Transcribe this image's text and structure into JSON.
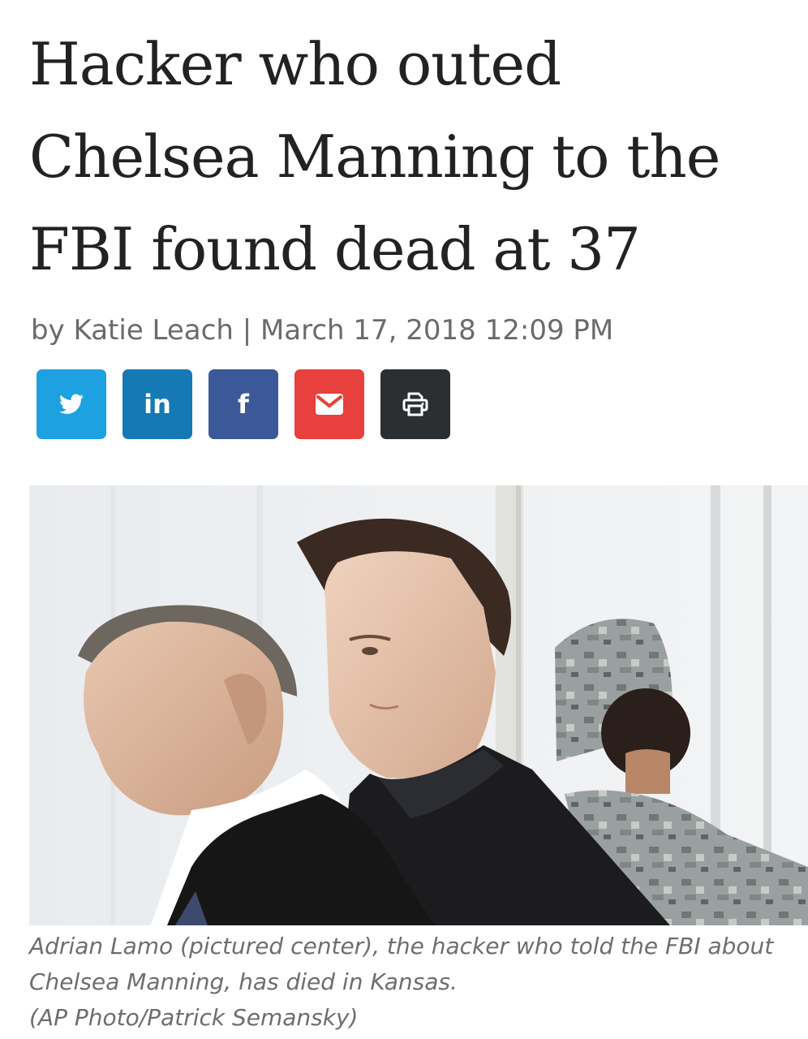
{
  "article": {
    "headline_lines": [
      "Hacker who outed",
      "Chelsea Manning to the",
      "FBI found dead at 37"
    ],
    "byline": "by Katie Leach | March 17, 2018 12:09 PM",
    "caption_lines": [
      "Adrian Lamo (pictured center), the hacker who told the FBI about",
      "Chelsea Manning, has died in Kansas.",
      "(AP Photo/Patrick Semansky)"
    ]
  },
  "share": {
    "buttons": [
      {
        "network": "twitter",
        "icon": "twitter-bird-icon",
        "color": "#1da1e0"
      },
      {
        "network": "linkedin",
        "icon": "linkedin-icon",
        "text": "in",
        "color": "#1479b5"
      },
      {
        "network": "facebook",
        "icon": "facebook-icon",
        "text": "f",
        "color": "#3b5998"
      },
      {
        "network": "email",
        "icon": "envelope-icon",
        "color": "#e8403c"
      },
      {
        "network": "print",
        "icon": "printer-icon",
        "color": "#2b2f31"
      }
    ]
  },
  "colors": {
    "headline": "#222222",
    "byline": "#6b6b6b",
    "caption": "#6e6e6e"
  }
}
